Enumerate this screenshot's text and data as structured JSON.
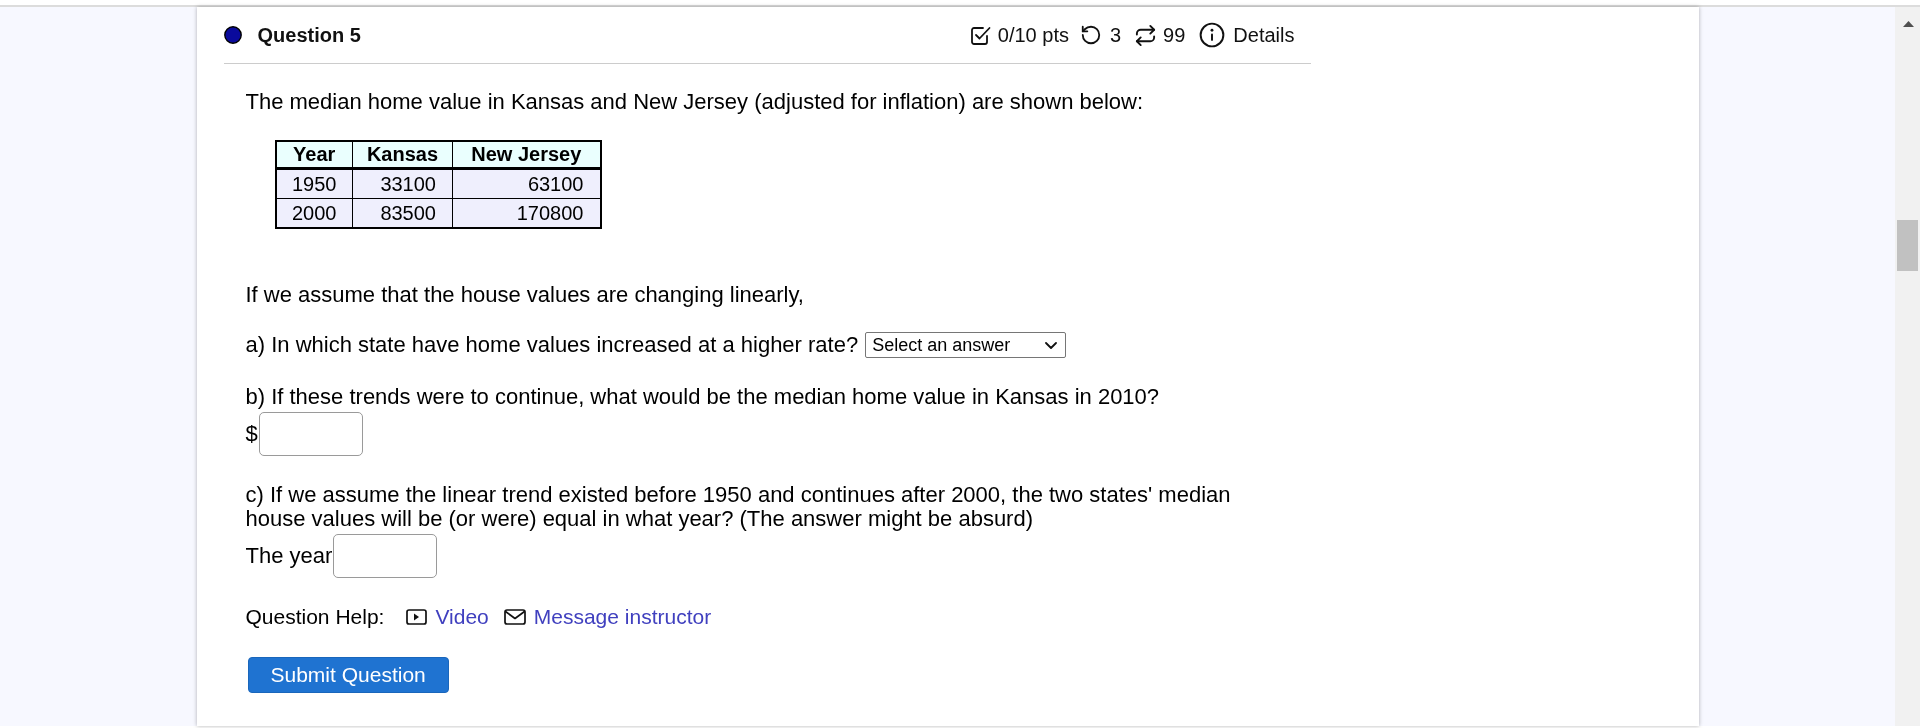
{
  "question_header": {
    "title": "Question 5",
    "score": "0/10 pts",
    "attempts_left": "3",
    "versions": "99",
    "details": "Details"
  },
  "intro": "The median home value in Kansas and New Jersey (adjusted for inflation) are shown below:",
  "table": {
    "columns": [
      "Year",
      "Kansas",
      "New Jersey"
    ],
    "rows": [
      [
        "1950",
        "33100",
        "63100"
      ],
      [
        "2000",
        "83500",
        "170800"
      ]
    ]
  },
  "lead": "If we assume that the house values are changing linearly,",
  "parts": [
    {
      "kind": "select",
      "prompt": "a) In which state have home values increased at a higher rate?",
      "value": "Select an answer"
    },
    {
      "kind": "input",
      "prompt": "b) If these trends were to continue, what would be the median home value in Kansas in 2010?",
      "prefix": "$"
    },
    {
      "kind": "input",
      "prompt": "c) If we assume the linear trend existed before 1950 and continues after 2000, the two states' median house values will be (or were) equal in what year? (The answer might be absurd)",
      "prefix": "The year"
    }
  ],
  "help": {
    "label": "Question Help:",
    "links": [
      {
        "kind": "video",
        "label": "Video"
      },
      {
        "kind": "message",
        "label": "Message instructor"
      }
    ]
  },
  "submit": "Submit Question"
}
